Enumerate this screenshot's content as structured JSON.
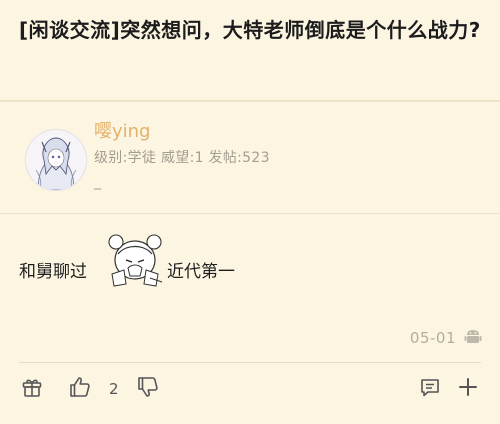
{
  "post": {
    "title": "[闲谈交流]突然想问，大特老师倒底是个什么战力?"
  },
  "author": {
    "username": "嘤ying",
    "stats": "级别:学徒 威望:1 发帖:523",
    "signature": "_"
  },
  "content": {
    "text_before": "和舅聊过",
    "text_after": "近代第一",
    "sticker": "anime-girl-sticker"
  },
  "meta": {
    "date": "05-01",
    "device_icon": "android-icon"
  },
  "actions": {
    "like_count": "2"
  },
  "colors": {
    "background": "#fcf5e2",
    "username": "#e3b26a",
    "muted": "#a49d92",
    "divider": "#efe3c7"
  }
}
